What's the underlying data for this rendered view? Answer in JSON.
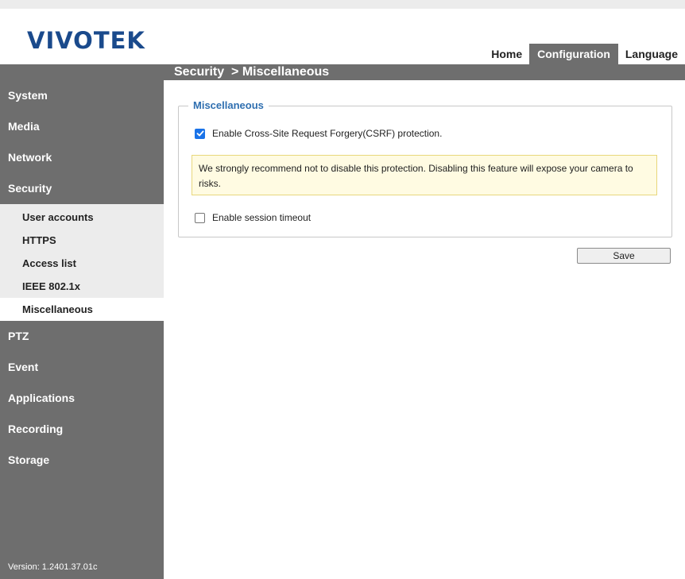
{
  "brand": {
    "logo_text": "VIVOTEK"
  },
  "topnav": {
    "tabs": [
      {
        "label": "Home"
      },
      {
        "label": "Configuration"
      },
      {
        "label": "Language"
      }
    ]
  },
  "breadcrumb": "Security  > Miscellaneous",
  "sidebar": {
    "items": [
      {
        "label": "System"
      },
      {
        "label": "Media"
      },
      {
        "label": "Network"
      },
      {
        "label": "Security"
      },
      {
        "label": "PTZ"
      },
      {
        "label": "Event"
      },
      {
        "label": "Applications"
      },
      {
        "label": "Recording"
      },
      {
        "label": "Storage"
      }
    ],
    "security_sub": [
      {
        "label": "User accounts"
      },
      {
        "label": "HTTPS"
      },
      {
        "label": "Access list"
      },
      {
        "label": "IEEE 802.1x"
      },
      {
        "label": "Miscellaneous"
      }
    ],
    "version": "Version: 1.2401.37.01c"
  },
  "panel": {
    "legend": "Miscellaneous",
    "csrf_label": "Enable Cross-Site Request Forgery(CSRF) protection.",
    "csrf_checked": true,
    "warning": "We strongly recommend not to disable this protection. Disabling this feature will expose your camera to risks.",
    "session_label": "Enable session timeout",
    "session_checked": false
  },
  "save_label": "Save",
  "colors": {
    "logo": "#1a4a8c",
    "bar": "#6e6e6e",
    "legend": "#2f6fb0",
    "checkbox": "#1a73e8",
    "warning_bg": "#fffbe2",
    "warning_border": "#e8d77c"
  },
  "icons": {
    "csrf_check": "checkmark-icon"
  }
}
